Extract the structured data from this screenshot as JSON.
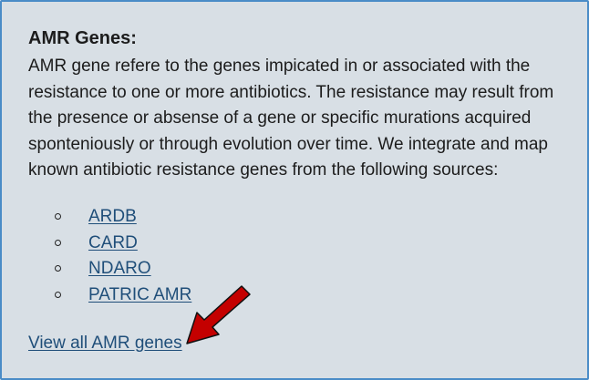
{
  "panel": {
    "heading": "AMR Genes:",
    "description": "AMR gene refere to the genes impicated in or associated with the resistance to one or more antibiotics. The resistance may result from the presence or absense of a gene or specific murations acquired sponteniously or through evolution over time. We integrate and map known antibiotic resistance genes from the following sources:",
    "sources": [
      {
        "label": "ARDB"
      },
      {
        "label": "CARD"
      },
      {
        "label": "NDARO"
      },
      {
        "label": "PATRIC AMR"
      }
    ],
    "view_all_label": "View all AMR genes"
  },
  "colors": {
    "panel_background": "#d8dfe5",
    "panel_border": "#4a8cc7",
    "link": "#1f4e79",
    "arrow_fill": "#c40000"
  },
  "icons": {
    "annotation_arrow": "red-arrow-icon",
    "list_bullet": "hollow-circle-bullet-icon"
  }
}
